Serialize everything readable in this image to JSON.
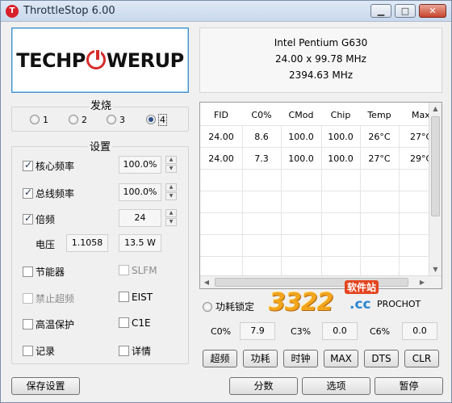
{
  "window": {
    "title": "ThrottleStop 6.00",
    "app_icon": "T"
  },
  "cpu": {
    "name": "Intel Pentium G630",
    "multiplier_bclk": "24.00 x 99.78 MHz",
    "speed": "2394.63 MHz"
  },
  "logo": {
    "pre": "TECHP",
    "post": "WERUP"
  },
  "profiles": {
    "label": "发烧",
    "options": [
      "1",
      "2",
      "3",
      "4"
    ],
    "selected": "4"
  },
  "settings": {
    "label": "设置",
    "core_freq": {
      "label": "核心频率",
      "value": "100.0%",
      "checked": true
    },
    "bus_freq": {
      "label": "总线频率",
      "value": "100.0%",
      "checked": true
    },
    "multiplier": {
      "label": "倍频",
      "value": "24",
      "checked": true
    },
    "voltage": {
      "label": "电压",
      "value": "1.1058",
      "power": "13.5 W"
    },
    "power_saver": {
      "label": "节能器"
    },
    "slfm": {
      "label": "SLFM"
    },
    "disable_turbo": {
      "label": "禁止超频"
    },
    "eist": {
      "label": "EIST"
    },
    "prochot_protect": {
      "label": "高温保护"
    },
    "c1e": {
      "label": "C1E"
    },
    "log": {
      "label": "记录"
    },
    "details": {
      "label": "详情"
    }
  },
  "table": {
    "columns": [
      "FID",
      "C0%",
      "CMod",
      "Chip",
      "Temp",
      "Max"
    ],
    "rows": [
      [
        "24.00",
        "8.6",
        "100.0",
        "100.0",
        "26°C",
        "27°C"
      ],
      [
        "24.00",
        "7.3",
        "100.0",
        "100.0",
        "27°C",
        "29°C"
      ]
    ]
  },
  "power_lock": {
    "label": "功耗锁定",
    "prochot": "PROCHOT"
  },
  "cstates": {
    "c0_label": "C0%",
    "c0_value": "7.9",
    "c3_label": "C3%",
    "c3_value": "0.0",
    "c6_label": "C6%",
    "c6_value": "0.0"
  },
  "tool_buttons": [
    "超频",
    "功耗",
    "时钟",
    "MAX",
    "DTS",
    "CLR"
  ],
  "bottom_buttons": {
    "save": "保存设置",
    "score": "分数",
    "options": "选项",
    "pause": "暂停"
  },
  "watermark": {
    "number": "3322",
    "tld": ".cc",
    "site": "软件站"
  },
  "colors": {
    "accent": "#4a90c8",
    "logo_red": "#d62c2c",
    "watermark_orange": "#f2a51d",
    "watermark_blue": "#2d86d2"
  }
}
